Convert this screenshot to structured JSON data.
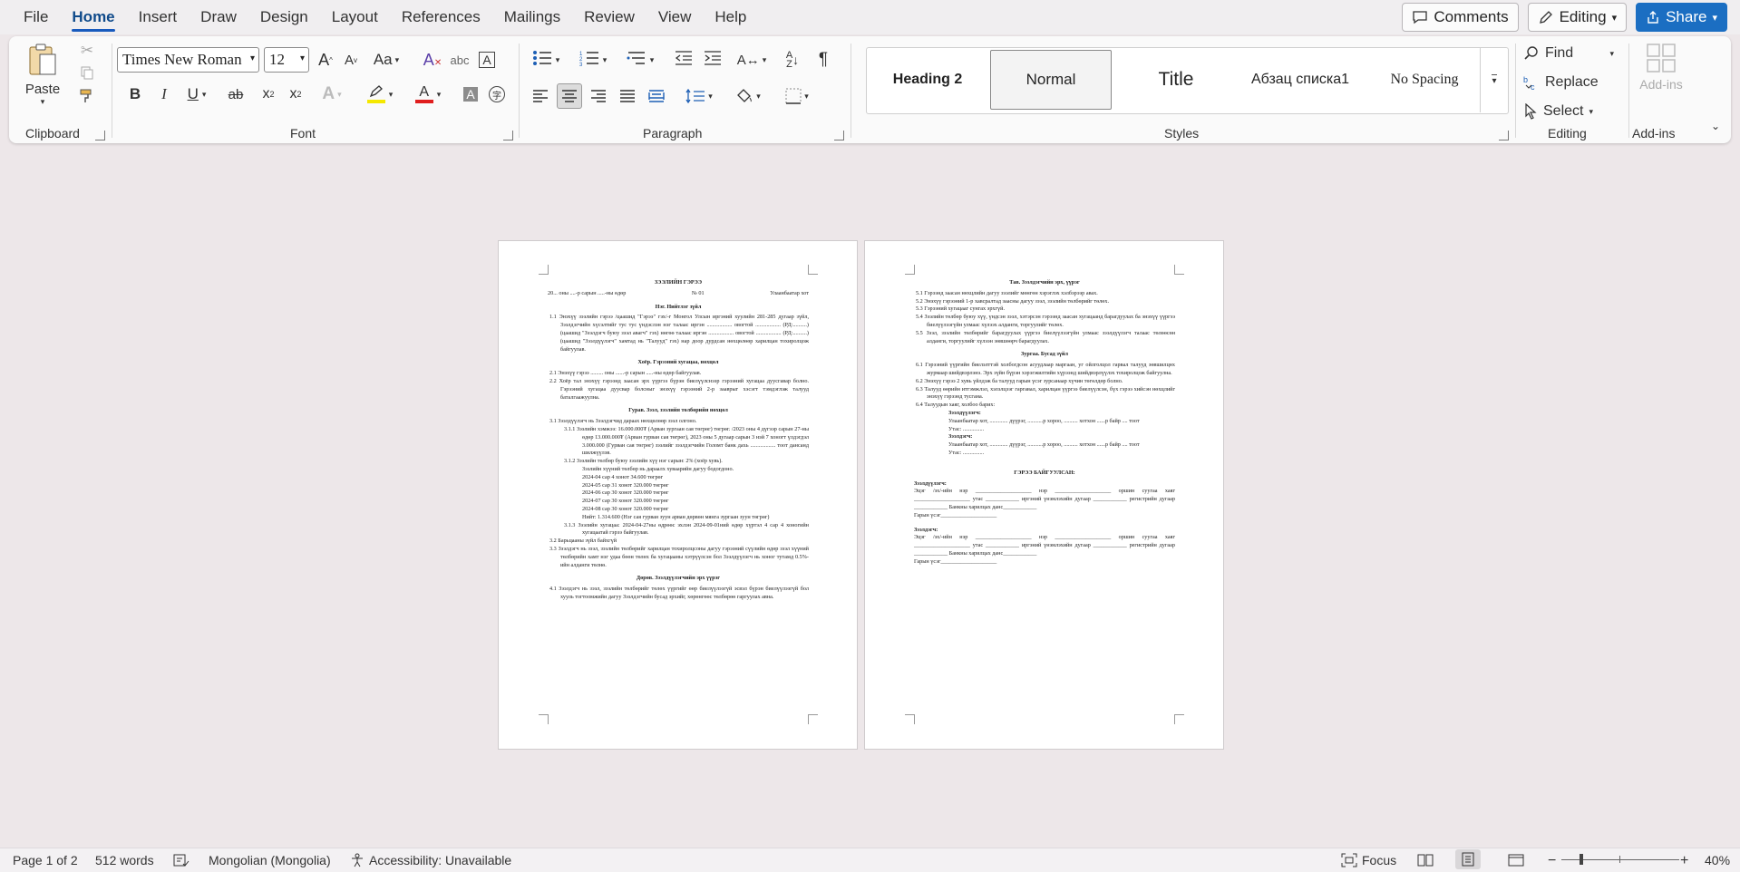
{
  "menu": {
    "tabs": [
      "File",
      "Home",
      "Insert",
      "Draw",
      "Design",
      "Layout",
      "References",
      "Mailings",
      "Review",
      "View",
      "Help"
    ],
    "active": "Home",
    "comments_label": "Comments",
    "editing_label": "Editing",
    "share_label": "Share"
  },
  "ribbon": {
    "clipboard": {
      "label": "Clipboard",
      "paste": "Paste"
    },
    "font": {
      "label": "Font",
      "name": "Times New Roman",
      "size": "12",
      "case_label": "Aa"
    },
    "paragraph": {
      "label": "Paragraph"
    },
    "styles": {
      "label": "Styles",
      "items": [
        "Heading 2",
        "Normal",
        "Title",
        "Абзац списка1",
        "No Spacing"
      ],
      "selected": "Normal"
    },
    "editing": {
      "label": "Editing",
      "find": "Find",
      "replace": "Replace",
      "select": "Select"
    },
    "addins": {
      "label": "Add-ins",
      "button": "Add-ins"
    }
  },
  "document": {
    "page1": [
      {
        "cls": "c",
        "text": "ЗЭЭЛИЙН ГЭРЭЭ"
      },
      {
        "cls": "row",
        "left": "20... оны ....-р сарын .....-ны өдөр",
        "mid": "№ 01",
        "right": "Улаанбаатар хот"
      },
      {
        "cls": "c",
        "text": "Нэг. Нийтлэг зүйл"
      },
      {
        "cls": "ind1",
        "text": "1.1 Энэхүү зээлийн гэрээ /цаашид \"Гэрээ\" гэх/-г Монгол Улсын иргэний хуулийн 281-285 дугаар зүйл, Зээлдэгчийн хүсэлтийг тус тус үндэслэн нэг талаас иргэн .................. овогтой .................. (РД:..........) (цаашид \"Зээлдэгч буюу зээл авагч\" гэх) нөгөө талаас иргэн .................. овогтой .................. (РД:..........) (цаашид \"Зээлдүүлэгч\" хамтад нь \"Талууд\" гэх) нар доор дурдсан нөхцөлөөр харилцан тохиролцож байгуулав."
      },
      {
        "cls": "c",
        "text": "Хоёр. Гэрээний хугацаа, нөхцөл"
      },
      {
        "cls": "ind1",
        "text": "2.1 Энэхүү гэрээ ......... оны ......-р сарын .....-ны өдөр байгуулав."
      },
      {
        "cls": "ind1",
        "text": "2.2 Хоёр тал энэхүү гэрээнд заасан эрх үүргээ бүрэн биелүүлснээр гэрээний хугацаа дуусгавар болно. Гэрээний хугацаа дуусвар болсныг энэхүү гэрээний 2-р зааврыг хэсэгт тэмдэглэж талууд баталгаажуулна."
      },
      {
        "cls": "c",
        "text": "Гурав. Зээл, зээлийн төлбөрийн нөхцөл"
      },
      {
        "cls": "ind1",
        "text": "3.1 Зээлдүүлэгч нь Зээлдэгчид дараах нөхцөлөөр зээл олгоно."
      },
      {
        "cls": "ind2",
        "text": "3.1.1 Зээлийн хэмжээ: 16.000.000₮ (Арван зургаан сая төгрөг) төгрөг. /2023 оны 4 дүгээр сарын 27-ны өдөр 13.000.000₮ (Арван гурван сая төгрөг), 2023 оны 5 дугаар сарын 3 нэй 7 хоногт үлдэгдэл 3.000.000 (Гурван сая төгрөг) зээлийг зээлдэгчийн Голомт банк дахь .................. тоот дансанд шилжүүлэв."
      },
      {
        "cls": "ind2",
        "text": "3.1.2 Зээлийн төлбөр буюу зээлийн хүү нэг сарын: 2% (хоёр хувь)."
      },
      {
        "cls": "ind3",
        "text": "Зээлийн хүүний төлбөр нь дараалх хуваарийн дагуу бодогдоно."
      },
      {
        "cls": "ind3",
        "text": "2024-04 сар 4 хонот 34.600 төгрөг"
      },
      {
        "cls": "ind3",
        "text": "2024-05 сар 31 хонот 320.000 төгрөг"
      },
      {
        "cls": "ind3",
        "text": "2024-06 сар 30 хонот 320.000 төгрөг"
      },
      {
        "cls": "ind3",
        "text": "2024-07 сар 30 хонот 320.000 төгрөг"
      },
      {
        "cls": "ind3",
        "text": "2024-08 сар 30 хонот 320.000 төгрөг"
      },
      {
        "cls": "ind3",
        "text": "Нийт: 1.314.600 (Нэг сая гурван зуун арван дөрвөн мянга зургаан зуун төгрөг)"
      },
      {
        "cls": "ind2",
        "text": "3.1.3 Зээлийн хугацаа: 2024-04-27ны өдрөөс эхлэн 2024-09-01ний өдөр хүртэл 4 сар 4 хоногийн хугацаатай гэрээ байгуулав."
      },
      {
        "cls": "ind1",
        "text": "3.2 Барьцааны зүйл байхгүй"
      },
      {
        "cls": "ind1",
        "text": "3.3 Зээлдэгч нь зээл, зээлийн төлбөрийг харилцан тохиролцсоны дагуу гэрээний сүүлийн өдөр зээл хүүний төлбөрийн хамт нэг удаа бөөн төлөх ба хугацааны хэтрүүлсэн бол Зээлдүүлэгч нь хоног тутамд 0.5%-ийн алданги төлнө."
      },
      {
        "cls": "c",
        "text": "Дөрөв. Зээлдүүлэгчийн эрх үүрэг"
      },
      {
        "cls": "ind1",
        "text": "4.1 Зээлдэгч нь зээл, зээлийн төлбөрийг төлөх үүргийг өөр биелүүлээгүй эсвэл бүрэн биелүүлээгүй бол хууль тогтоомжийн дагуу Зээлдэгчийн бусад эрхийг, хөрөнгөөс төлбөрөө гаргуулах авна."
      }
    ],
    "page2": [
      {
        "cls": "c",
        "text": "Тав. Зээлдэгчийн эрх, үүрэг"
      },
      {
        "cls": "ind1",
        "text": "5.1 Гэрээнд заасан нөхцлийн дагуу зээлийг мөнгөн хэрэглэх хэлбэрээр авах."
      },
      {
        "cls": "ind1",
        "text": "5.2 Энэхүү гэрээний 1-р хавсралтад заасны дагуу зээл, зээлийн төлбөрийг төлөх."
      },
      {
        "cls": "ind1",
        "text": "5.3 Гэрээний хугацааг сунгах эрхгүй."
      },
      {
        "cls": "ind1",
        "text": "5.4 Зээлийн төлбөр буюу хүү, үндсэн зээл, хэтэрсэн гэрээнд заасан хугацаанд барагдуулах ба энэхүү үүргээ биелүүлээгүйн улмаас хүлээх алданги, торгуулийг төлөх."
      },
      {
        "cls": "ind1",
        "text": "5.5 Зээл, зээлийн төлбөрийг барагдуулах үүргээ биелүүлээгүйн улмаас зээлдүүлэгч талаас төлөөсөн алданги, торгуулийг хүлээн зөвшөөрч барагдуулах."
      },
      {
        "cls": "c",
        "text": "Зургаа. Бусад зүйл"
      },
      {
        "cls": "ind1",
        "text": "6.1 Гэрээний үүргийн биелэлттэй холбогдсон асуудлаар маргаан, уг ойлголцол гарвал талууд зөвшилцөх журмаар шийдвэрлэнэ. Эрх зүйн бүрэн хэрэгжилтийн хүрээнд шийдвэрлүүлэх тохиролцож байгуулна."
      },
      {
        "cls": "ind1",
        "text": "6.2 Энэхүү гэрээ 2 хувь үйлдэж ба талууд гарын үсэг зурсанаар хүчин төгөлдөр болно."
      },
      {
        "cls": "ind1",
        "text": "6.3 Талууд өөрийн итгэмжлэл, хэлэлцээг гаргавал, харилцан үүргээ биелүүлсэн, бүх гэрээ хийсэн нөхцлийг энэхүү гэрээнд тусгана."
      },
      {
        "cls": "ind1",
        "text": "6.4 Талуудын хаяг, холбоо барих:"
      },
      {
        "cls": "ind3 b",
        "text": "Зээлдүүлэгч:"
      },
      {
        "cls": "ind3",
        "text": "Улаанбаатар хот, ............. дүүрэг, ...........р хороо, .......... хотхон ......р байр .... тоот"
      },
      {
        "cls": "ind3",
        "text": "Утас: ..............."
      },
      {
        "cls": "ind3 b",
        "text": "Зээлдэгч:"
      },
      {
        "cls": "ind3",
        "text": "Улаанбаатар хот, ............. дүүрэг, ...........р хороо, .......... хотхон ......р байр .... тоот"
      },
      {
        "cls": "ind3",
        "text": "Утас: ..............."
      },
      {
        "cls": "gap",
        "text": ""
      },
      {
        "cls": "c",
        "text": "ГЭРЭЭ БАЙГУУЛСАН:"
      },
      {
        "cls": "b",
        "text": "Зээлдүүлэгч:"
      },
      {
        "cls": "",
        "text": "Эцэг /эх/-ийн нэр ____________________ нэр ____________________ оршин суугаа хаяг ____________________ утас ____________ иргэний үнэмлэхийн дугаар ____________ регистрийн дугаар ____________ Банкны харилцах данс____________"
      },
      {
        "cls": "",
        "text": "Гарын үсэг____________________"
      },
      {
        "cls": "gap",
        "text": ""
      },
      {
        "cls": "b",
        "text": "Зээлдэгч:"
      },
      {
        "cls": "",
        "text": "Эцэг /эх/-ийн нэр ____________________ нэр ____________________ оршин суугаа хаяг ____________________ утас ____________ иргэний үнэмлэхийн дугаар ____________ регистрийн дугаар ____________ Банкны харилцах данс____________"
      },
      {
        "cls": "",
        "text": "Гарын үсэг____________________"
      }
    ]
  },
  "status": {
    "page": "Page 1 of 2",
    "words": "512 words",
    "language": "Mongolian (Mongolia)",
    "accessibility": "Accessibility: Unavailable",
    "focus": "Focus",
    "zoom": "40%"
  },
  "colors": {
    "accent": "#185abd",
    "share_bg": "#1b6ec2",
    "highlight": "#f5e800",
    "font_color": "#e01e1e"
  }
}
